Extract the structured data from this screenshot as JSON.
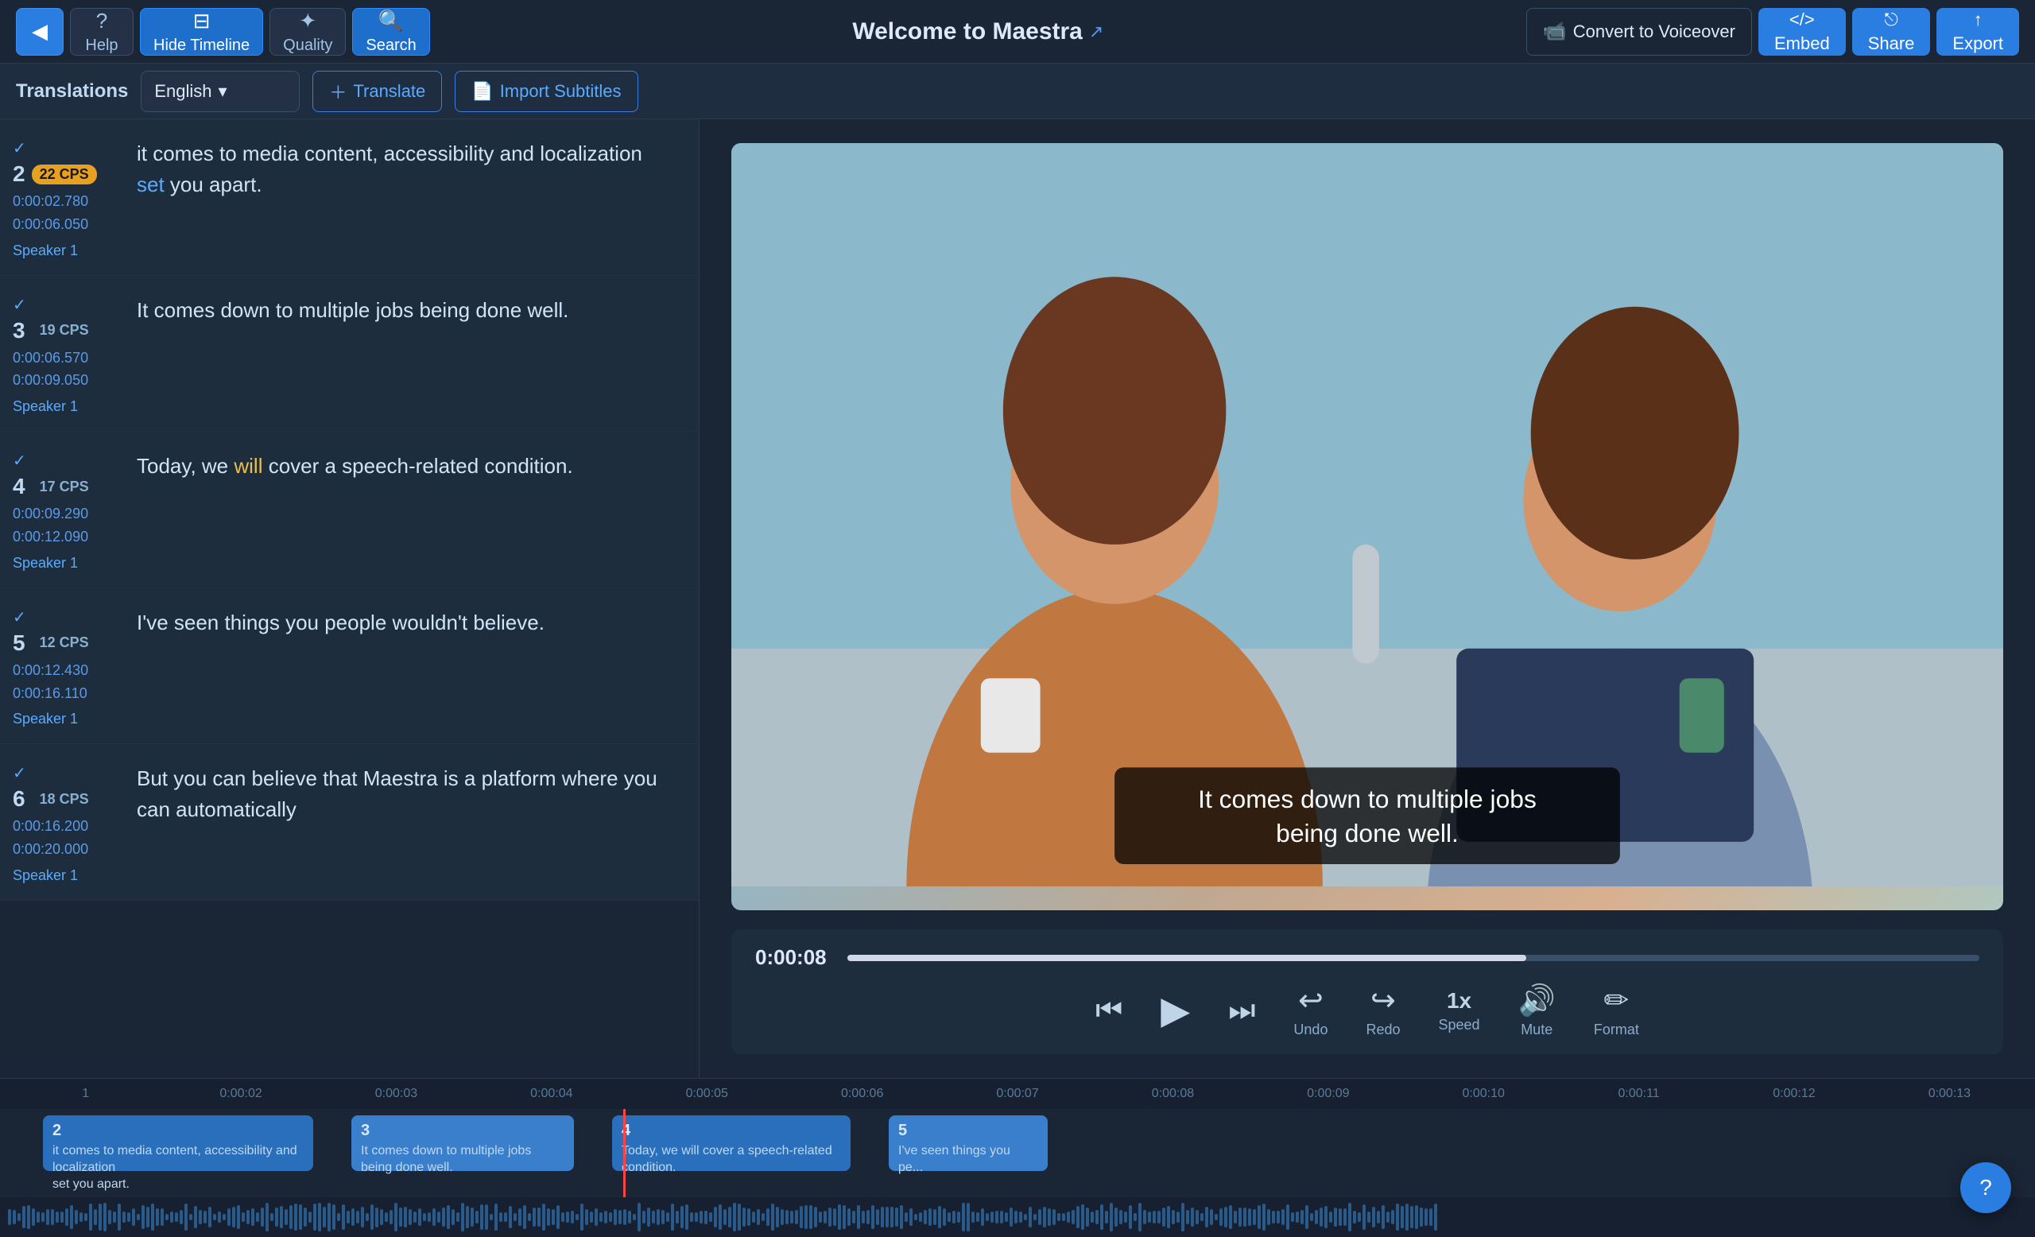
{
  "toolbar": {
    "back_label": "←",
    "help_label": "Help",
    "hide_timeline_label": "Hide Timeline",
    "quality_label": "Quality",
    "search_label": "Search",
    "title": "Welcome to Maestra",
    "convert_voiceover_label": "Convert to Voiceover",
    "embed_label": "Embed",
    "share_label": "Share",
    "export_label": "Export"
  },
  "secondary_toolbar": {
    "translations_label": "Translations",
    "language": "English",
    "translate_label": "Translate",
    "import_subtitles_label": "Import Subtitles"
  },
  "subtitles": [
    {
      "id": 2,
      "cps": "22 CPS",
      "cps_type": "yellow",
      "time_start": "0:00:02.780",
      "time_end": "0:00:06.050",
      "speaker": "Speaker 1",
      "text": "it comes to media content, accessibility and localization set you apart.",
      "highlight": "set"
    },
    {
      "id": 3,
      "cps": "19 CPS",
      "cps_type": "normal",
      "time_start": "0:00:06.570",
      "time_end": "0:00:09.050",
      "speaker": "Speaker 1",
      "text": "It comes down to multiple jobs being done well.",
      "highlight": ""
    },
    {
      "id": 4,
      "cps": "17 CPS",
      "cps_type": "normal",
      "time_start": "0:00:09.290",
      "time_end": "0:00:12.090",
      "speaker": "Speaker 1",
      "text": "Today, we will cover a speech-related condition.",
      "highlight": "will"
    },
    {
      "id": 5,
      "cps": "12 CPS",
      "cps_type": "normal",
      "time_start": "0:00:12.430",
      "time_end": "0:00:16.110",
      "speaker": "Speaker 1",
      "text": "I've seen things you people wouldn't believe.",
      "highlight": ""
    },
    {
      "id": 6,
      "cps": "18 CPS",
      "cps_type": "normal",
      "time_start": "0:00:16.200",
      "time_end": "0:00:20.000",
      "speaker": "Speaker 1",
      "text": "But you can believe that Maestra is a platform where you can automatically",
      "highlight": ""
    }
  ],
  "player": {
    "current_time": "0:00:08",
    "progress_percent": 60,
    "subtitle_overlay_line1": "It comes down to multiple jobs",
    "subtitle_overlay_line2": "being done well.",
    "undo_label": "Undo",
    "redo_label": "Redo",
    "speed_label": "Speed",
    "mute_label": "Mute",
    "format_label": "Format",
    "speed_value": "1x"
  },
  "timeline": {
    "ruler_marks": [
      "1",
      "0:00:02",
      "0:00:03",
      "0:00:04",
      "0:00:05",
      "0:00:06",
      "0:00:07",
      "0:00:08",
      "0:00:09",
      "0:00:10",
      "0:00:11",
      "0:00:12",
      "0:00:13"
    ],
    "segments": [
      {
        "id": 2,
        "text_part1": "it comes to media content, accessibility and localization",
        "text_part2": "set you apart."
      },
      {
        "id": 3,
        "text": "It comes down to multiple jobs being done well."
      },
      {
        "id": 4,
        "text": "Today, we will cover a speech-related condition."
      },
      {
        "id": 5,
        "text": "I've seen things you pe..."
      }
    ]
  },
  "help_fab_label": "?"
}
